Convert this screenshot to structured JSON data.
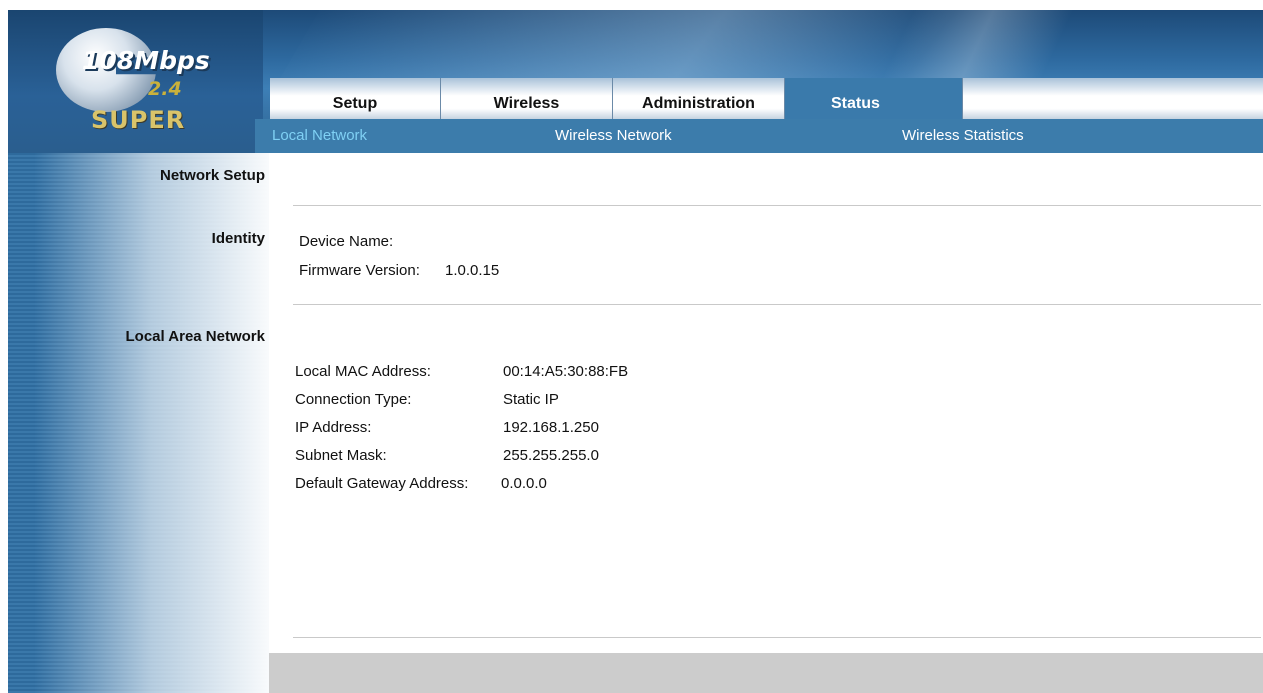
{
  "logo": {
    "speed": "108Mbps",
    "band": "2.4",
    "brand": "SUPER"
  },
  "tabs": [
    {
      "label": "Setup"
    },
    {
      "label": "Wireless"
    },
    {
      "label": "Administration"
    },
    {
      "label": "Status",
      "active": true
    }
  ],
  "subnav": [
    {
      "label": "Local Network",
      "current": true
    },
    {
      "label": "Wireless Network"
    },
    {
      "label": "Wireless Statistics"
    }
  ],
  "sections": {
    "network_setup": "Network Setup",
    "identity": "Identity",
    "local_area_network": "Local Area Network"
  },
  "identity": {
    "device_name_label": "Device Name:",
    "device_name_value": "",
    "firmware_label": "Firmware Version:",
    "firmware_value": "1.0.0.15"
  },
  "lan": {
    "mac_label": "Local MAC Address:",
    "mac_value": "00:14:A5:30:88:FB",
    "conn_label": "Connection Type:",
    "conn_value": "Static IP",
    "ip_label": "IP Address:",
    "ip_value": "192.168.1.250",
    "mask_label": "Subnet Mask:",
    "mask_value": "255.255.255.0",
    "gw_label": "Default Gateway Address:",
    "gw_value": "0.0.0.0"
  },
  "colors": {
    "header_blue": "#3a7aab",
    "current_link": "#7fd0f4",
    "footer_gray": "#cccccc"
  }
}
